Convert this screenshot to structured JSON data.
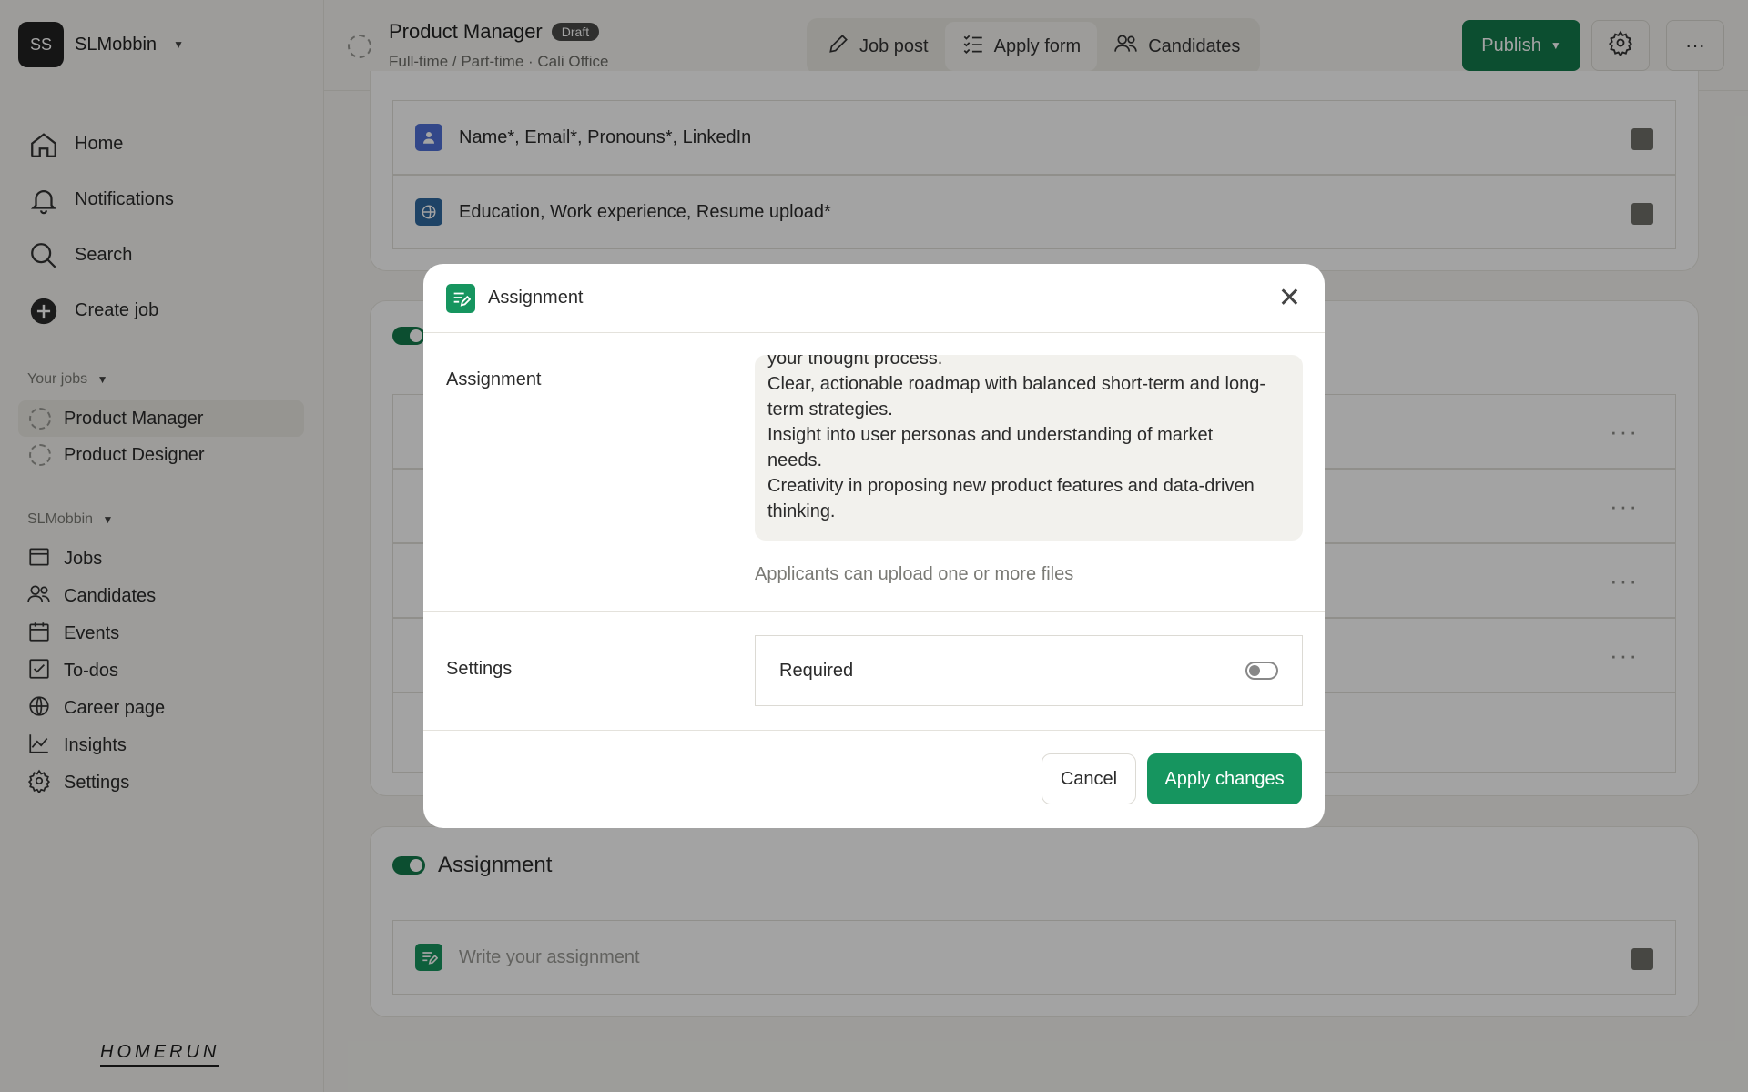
{
  "sidebar": {
    "workspace_initials": "SS",
    "workspace_name": "SLMobbin",
    "nav": [
      {
        "label": "Home",
        "icon": "home-icon"
      },
      {
        "label": "Notifications",
        "icon": "bell-icon"
      },
      {
        "label": "Search",
        "icon": "search-icon"
      },
      {
        "label": "Create job",
        "icon": "plus-circle-icon"
      }
    ],
    "your_jobs_label": "Your jobs",
    "jobs": [
      "Product Manager",
      "Product Designer"
    ],
    "org_label": "SLMobbin",
    "org_nav": [
      {
        "label": "Jobs",
        "icon": "jobs-icon"
      },
      {
        "label": "Candidates",
        "icon": "candidates-icon"
      },
      {
        "label": "Events",
        "icon": "calendar-icon"
      },
      {
        "label": "To-dos",
        "icon": "checkbox-icon"
      },
      {
        "label": "Career page",
        "icon": "globe-icon"
      },
      {
        "label": "Insights",
        "icon": "chart-icon"
      },
      {
        "label": "Settings",
        "icon": "gear-icon"
      }
    ],
    "logo": "HOMERUN"
  },
  "header": {
    "title": "Product Manager",
    "badge": "Draft",
    "subtitle": "Full-time / Part-time · Cali Office",
    "tabs": [
      {
        "label": "Job post",
        "icon": "pencil-icon"
      },
      {
        "label": "Apply form",
        "icon": "checklist-icon"
      },
      {
        "label": "Candidates",
        "icon": "people-icon"
      }
    ],
    "publish_label": "Publish",
    "more_label": "···"
  },
  "main": {
    "rows": [
      {
        "label": "Name*, Email*, Pronouns*, LinkedIn",
        "color": "#4f6fd6"
      },
      {
        "label": "Education, Work experience, Resume upload*",
        "color": "#2f6aa0"
      }
    ],
    "assignment_section_title": "Assignment",
    "assignment_placeholder": "Write your assignment"
  },
  "modal": {
    "title": "Assignment",
    "assignment_label": "Assignment",
    "assignment_lines": [
      "your thought process.",
      "Clear, actionable roadmap with balanced short-term and long-",
      "term strategies.",
      "Insight into user personas and understanding of market",
      "needs.",
      "Creativity in proposing new product features and data-driven",
      "thinking."
    ],
    "helper_text": "Applicants can upload one or more files",
    "settings_label": "Settings",
    "required_label": "Required",
    "required_on": false,
    "cancel_label": "Cancel",
    "apply_label": "Apply changes"
  },
  "colors": {
    "accent": "#137a4b",
    "apply_button": "#16955f",
    "overlay": "rgba(0,0,0,0.36)"
  }
}
